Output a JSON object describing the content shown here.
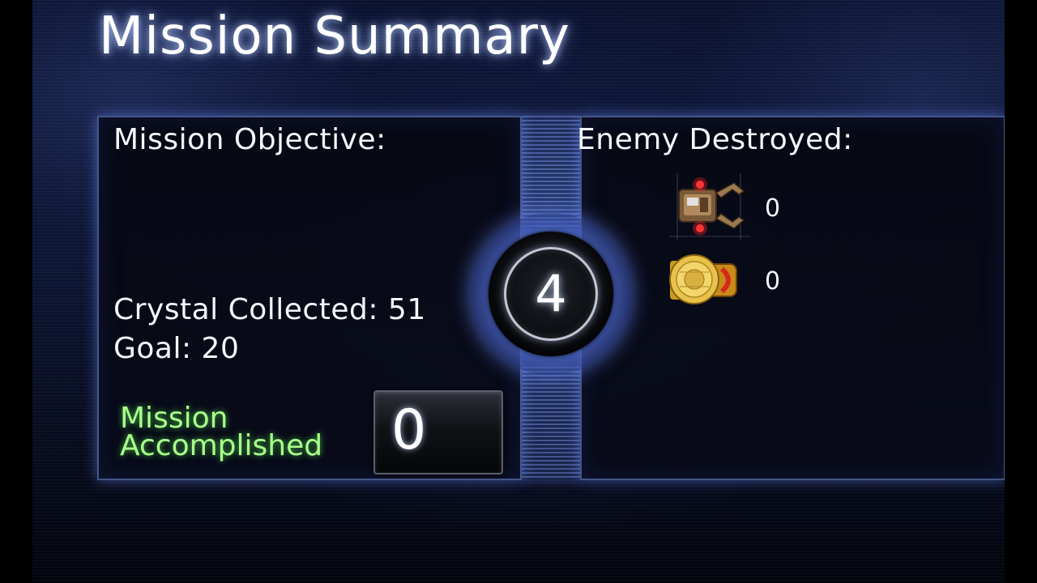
{
  "title": "Mission Summary",
  "objective_panel": {
    "heading": "Mission Objective:",
    "crystal_label": "Crystal Collected: 51",
    "goal_label": "Goal: 20",
    "status_line1": "Mission",
    "status_line2": "Accomplished",
    "score_value": "0"
  },
  "center_badge": {
    "value": "4"
  },
  "enemy_panel": {
    "heading": "Enemy Destroyed:",
    "enemies": [
      {
        "icon": "claw-ship-icon",
        "count": "0"
      },
      {
        "icon": "gold-disc-ship-icon",
        "count": "0"
      }
    ]
  },
  "colors": {
    "accomplished_text": "#a8ff8a",
    "panel_glow": "#6e8cff",
    "background": "#0b1330"
  }
}
